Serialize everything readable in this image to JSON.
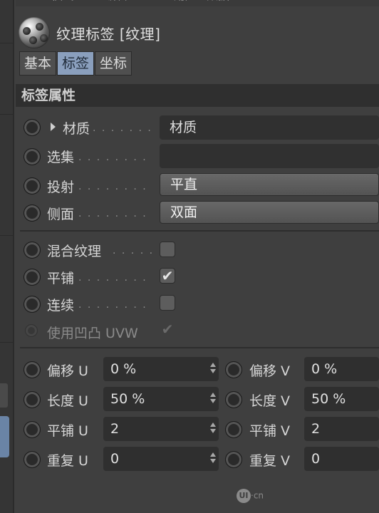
{
  "top_menu": [
    "模式",
    "编辑",
    "用户",
    "数据"
  ],
  "object": {
    "title": "纹理标签 [纹理]",
    "icon": "texture-tag-sphere-icon"
  },
  "tabs": [
    {
      "label": "基本",
      "active": false
    },
    {
      "label": "标签",
      "active": true
    },
    {
      "label": "坐标",
      "active": false
    }
  ],
  "section": {
    "title": "标签属性"
  },
  "properties": {
    "material": {
      "label": "材质",
      "dots": ". . . . . . .",
      "value": "材质"
    },
    "selection": {
      "label": "选集",
      "dots": ". . . . . . . .",
      "value": ""
    },
    "projection": {
      "label": "投射",
      "dots": ". . . . . . . .",
      "value": "平直"
    },
    "side": {
      "label": "侧面",
      "dots": ". . . . . . . .",
      "value": "双面"
    },
    "mix_textures": {
      "label": "混合纹理",
      "dots": ". . . . . .",
      "checked": false
    },
    "tile": {
      "label": "平铺",
      "dots": ". . . . . . . .",
      "checked": true
    },
    "seamless": {
      "label": "连续",
      "dots": ". . . . . . . .",
      "checked": false
    },
    "use_uvw_bump": {
      "label": "使用凹凸 UVW",
      "checked": true,
      "enabled": false
    }
  },
  "uv_params": {
    "offset_u": {
      "label": "偏移 U",
      "value": "0 %"
    },
    "offset_v": {
      "label": "偏移 V",
      "value": "0 %"
    },
    "length_u": {
      "label": "长度 U",
      "value": "50 %"
    },
    "length_v": {
      "label": "长度 V",
      "value": "50 %"
    },
    "tiles_u": {
      "label": "平铺 U",
      "value": "2"
    },
    "tiles_v": {
      "label": "平铺 V",
      "value": "2"
    },
    "repeat_u": {
      "label": "重复 U",
      "value": "0"
    },
    "repeat_v": {
      "label": "重复 V",
      "value": "0"
    }
  },
  "checkmark_glyph": "✔",
  "watermark": {
    "logo": "UI",
    "text": "·cn"
  }
}
